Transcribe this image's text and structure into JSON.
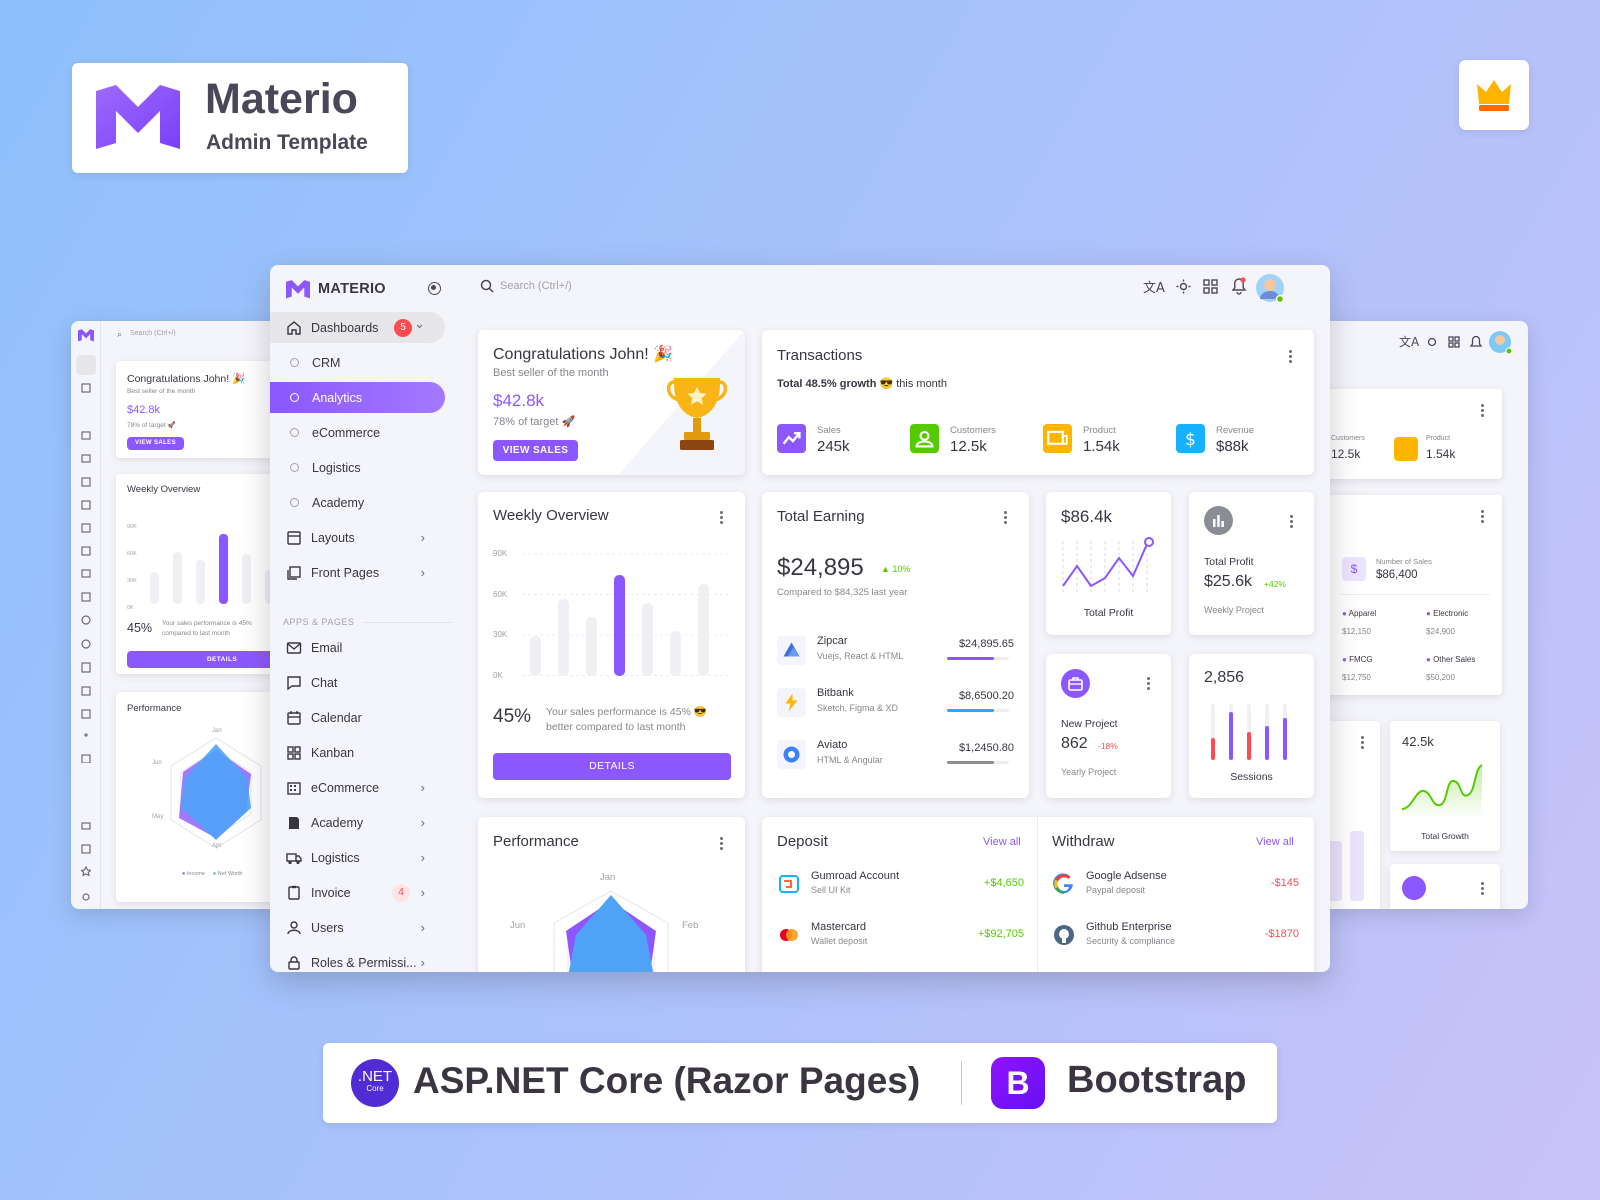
{
  "brand": {
    "name": "Materio",
    "subtitle": "Admin Template"
  },
  "footer": {
    "net_line1": ".NET",
    "net_line2": "Core",
    "asp_label": "ASP.NET Core (Razor Pages)",
    "bootstrap_letter": "B",
    "bootstrap_label": "Bootstrap"
  },
  "app": {
    "logo": "MATERIO",
    "search_placeholder": "Search (Ctrl+/)",
    "nav": [
      {
        "label": "Dashboards",
        "badge": "5",
        "icon": "home-icon"
      },
      {
        "label": "CRM"
      },
      {
        "label": "Analytics"
      },
      {
        "label": "eCommerce"
      },
      {
        "label": "Logistics"
      },
      {
        "label": "Academy"
      },
      {
        "label": "Layouts",
        "icon": "layouts-icon"
      },
      {
        "label": "Front Pages",
        "icon": "front-pages-icon"
      },
      {
        "label": "Email",
        "icon": "mail-icon"
      },
      {
        "label": "Chat",
        "icon": "chat-icon"
      },
      {
        "label": "Calendar",
        "icon": "calendar-icon"
      },
      {
        "label": "Kanban",
        "icon": "kanban-icon"
      },
      {
        "label": "eCommerce",
        "icon": "shop-icon"
      },
      {
        "label": "Academy",
        "icon": "academy-icon"
      },
      {
        "label": "Logistics",
        "icon": "truck-icon"
      },
      {
        "label": "Invoice",
        "badge": "4",
        "icon": "invoice-icon"
      },
      {
        "label": "Users",
        "icon": "user-icon"
      },
      {
        "label": "Roles & Permissi...",
        "icon": "lock-icon"
      }
    ],
    "section_label": "APPS & PAGES",
    "congrats": {
      "title": "Congratulations John! 🎉",
      "subtitle": "Best seller of the month",
      "amount": "$42.8k",
      "target": "78% of target 🚀",
      "button": "VIEW SALES"
    },
    "transactions": {
      "title": "Transactions",
      "growth_bold": "Total 48.5% growth",
      "growth_rest": " 😎 this month",
      "stats": [
        {
          "label": "Sales",
          "value": "245k",
          "color": "#8c57ff"
        },
        {
          "label": "Customers",
          "value": "12.5k",
          "color": "#56ca00"
        },
        {
          "label": "Product",
          "value": "1.54k",
          "color": "#ffb400"
        },
        {
          "label": "Revenue",
          "value": "$88k",
          "color": "#16b1ff"
        }
      ]
    },
    "weekly": {
      "title": "Weekly Overview",
      "ticks": [
        "90K",
        "60K",
        "30K",
        "0K"
      ],
      "percent": "45%",
      "text": "Your sales performance is 45% 😎 better compared to last month",
      "button": "DETAILS"
    },
    "earning": {
      "title": "Total Earning",
      "amount": "$24,895",
      "change": "10%",
      "compare": "Compared to $84,325 last year",
      "items": [
        {
          "name": "Zipcar",
          "sub": "Vuejs, React & HTML",
          "amount": "$24,895.65",
          "progress": 0.75,
          "color": "#8c57ff"
        },
        {
          "name": "Bitbank",
          "sub": "Sketch, Figma & XD",
          "amount": "$8,6500.20",
          "progress": 0.75,
          "color": "#16b1ff"
        },
        {
          "name": "Aviato",
          "sub": "HTML & Angular",
          "amount": "$1,2450.80",
          "progress": 0.75,
          "color": "#8a8d93"
        }
      ]
    },
    "profit_chart": {
      "value": "$86.4k",
      "label": "Total Profit"
    },
    "total_profit": {
      "label": "Total Profit",
      "value": "$25.6k",
      "change": "+42%",
      "sub": "Weekly Project"
    },
    "new_project": {
      "label": "New Project",
      "value": "862",
      "change": "-18%",
      "sub": "Yearly Project"
    },
    "sessions": {
      "value": "2,856",
      "label": "Sessions"
    },
    "performance": {
      "title": "Performance",
      "labels": [
        "Jan",
        "Feb",
        "Jun"
      ]
    },
    "deposit": {
      "title": "Deposit",
      "view_all": "View all",
      "items": [
        {
          "name": "Gumroad Account",
          "sub": "Sell UI Kit",
          "amount": "+$4,650"
        },
        {
          "name": "Mastercard",
          "sub": "Wallet deposit",
          "amount": "+$92,705"
        }
      ]
    },
    "withdraw": {
      "title": "Withdraw",
      "view_all": "View all",
      "items": [
        {
          "name": "Google Adsense",
          "sub": "Paypal deposit",
          "amount": "-$145"
        },
        {
          "name": "Github Enterprise",
          "sub": "Security & compliance",
          "amount": "-$1870"
        }
      ]
    }
  },
  "left_preview": {
    "search": "Search (Ctrl+/)",
    "congrats_title": "Congratulations John! 🎉",
    "congrats_sub": "Best seller of the month",
    "amount": "$42.8k",
    "target": "78% of target 🚀",
    "button": "VIEW SALES",
    "weekly": "Weekly Overview",
    "ticks": [
      "90K",
      "60K",
      "30K",
      "0K"
    ],
    "percent": "45%",
    "perf_text": "Your sales performance is 45%",
    "perf_text2": "compared to last month",
    "details": "DETAILS",
    "performance": "Performance",
    "radar_labels": [
      "Jan",
      "Jun",
      "May",
      "Apr"
    ],
    "legend": [
      "Income",
      "Net Worth"
    ]
  },
  "right_preview": {
    "customers_label": "Customers",
    "customers": "12.5k",
    "product_label": "Product",
    "product": "1.54k",
    "sales_label": "Number of Sales",
    "sales": "$86,400",
    "cats": [
      {
        "name": "Apparel",
        "value": "$12,150"
      },
      {
        "name": "Electronic",
        "value": "$24,900"
      },
      {
        "name": "FMCG",
        "value": "$12,750"
      },
      {
        "name": "Other Sales",
        "value": "$50,200"
      }
    ],
    "growth": "42.5k",
    "growth_label": "Total Growth"
  }
}
